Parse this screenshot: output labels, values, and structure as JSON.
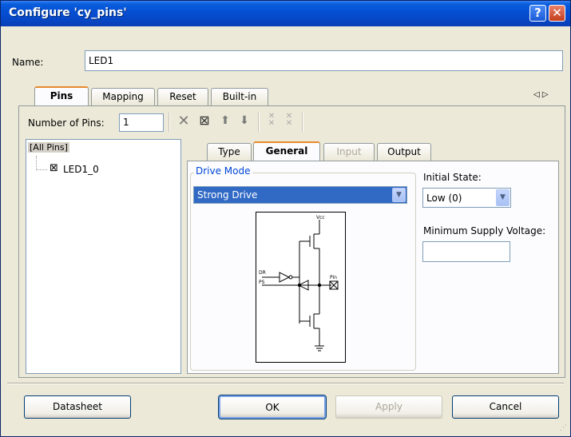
{
  "window": {
    "title": "Configure 'cy_pins'"
  },
  "name_field": {
    "label": "Name:",
    "value": "LED1"
  },
  "outer_tabs": [
    {
      "label": "Pins",
      "active": true
    },
    {
      "label": "Mapping"
    },
    {
      "label": "Reset"
    },
    {
      "label": "Built-in"
    }
  ],
  "scroll_arrows": "◁ ▷",
  "pins_toolbar": {
    "count_label": "Number of Pins:",
    "count_value": "1"
  },
  "tree": {
    "root": "[All Pins]",
    "items": [
      "LED1_0"
    ]
  },
  "inner_tabs": [
    {
      "label": "Type"
    },
    {
      "label": "General",
      "active": true
    },
    {
      "label": "Input",
      "disabled": true
    },
    {
      "label": "Output"
    }
  ],
  "drive_mode": {
    "label": "Drive Mode",
    "value": "Strong Drive"
  },
  "schematic": {
    "vcc": "Vcc",
    "dr": "DR",
    "ps": "PS",
    "pin": "Pin"
  },
  "initial_state": {
    "label": "Initial State:",
    "value": "Low (0)"
  },
  "min_supply": {
    "label": "Minimum Supply Voltage:",
    "value": ""
  },
  "buttons": {
    "datasheet": "Datasheet",
    "ok": "OK",
    "apply": "Apply",
    "cancel": "Cancel"
  }
}
